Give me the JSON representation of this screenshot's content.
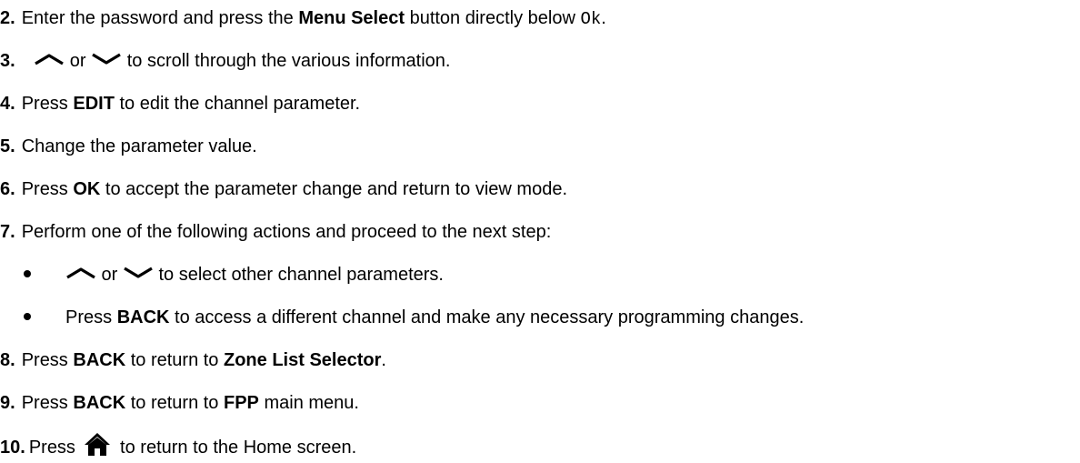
{
  "steps": [
    {
      "num": "2.",
      "pre": "Enter the password and press the ",
      "bold": "Menu Select",
      "mid": " button directly below ",
      "code": "Ok",
      "post": "."
    },
    {
      "num": "3.",
      "or": " or ",
      "post": " to scroll through the various information."
    },
    {
      "num": "4.",
      "pre": "Press ",
      "bold": "EDIT",
      "post": " to edit the channel parameter."
    },
    {
      "num": "5.",
      "text": "Change the parameter value."
    },
    {
      "num": "6.",
      "pre": "Press ",
      "bold": "OK",
      "post": " to accept the parameter change and return to view mode."
    },
    {
      "num": "7.",
      "text": "Perform one of the following actions and proceed to the next step:"
    },
    {
      "num": "8.",
      "pre": "Press ",
      "bold": "BACK",
      "mid": " to return to ",
      "bold2": "Zone List Selector",
      "post": "."
    },
    {
      "num": "9.",
      "pre": "Press ",
      "bold": "BACK",
      "mid": " to return to ",
      "bold2": "FPP",
      "post": " main menu."
    },
    {
      "num": "10.",
      "pre": "Press ",
      "post": " to return to the Home screen."
    }
  ],
  "bullets": [
    {
      "or": " or ",
      "post": " to select other channel parameters."
    },
    {
      "pre": "Press ",
      "bold": "BACK",
      "post": " to access a different channel and make any necessary programming changes."
    }
  ],
  "icons": {
    "up": "chevron-up-icon",
    "down": "chevron-down-icon",
    "home": "home-icon"
  }
}
